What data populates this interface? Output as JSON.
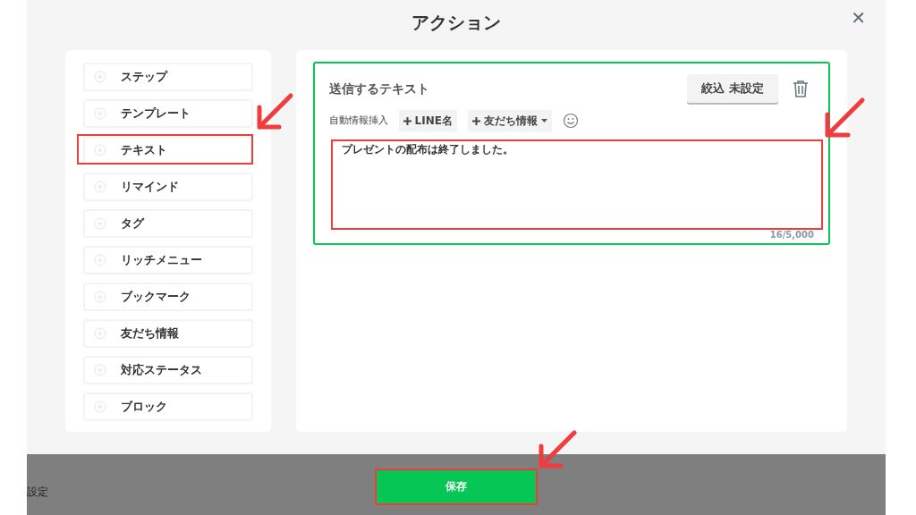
{
  "dialog": {
    "title": "アクション",
    "close": "✕"
  },
  "sidebar": {
    "items": [
      {
        "label": "ステップ"
      },
      {
        "label": "テンプレート"
      },
      {
        "label": "テキスト"
      },
      {
        "label": "リマインド"
      },
      {
        "label": "タグ"
      },
      {
        "label": "リッチメニュー"
      },
      {
        "label": "ブックマーク"
      },
      {
        "label": "友だち情報"
      },
      {
        "label": "対応ステータス"
      },
      {
        "label": "ブロック"
      }
    ]
  },
  "text_action": {
    "title": "送信するテキスト",
    "filter_button": "絞込 未設定",
    "insert_label": "自動情報挿入",
    "insert_buttons": [
      {
        "label": "LINE名",
        "dropdown": false
      },
      {
        "label": "友だち情報",
        "dropdown": true
      }
    ],
    "message": "プレゼントの配布は終了しました。",
    "counter": "16/5,000"
  },
  "background": {
    "partial_label": "設定"
  },
  "save_button": "保存"
}
